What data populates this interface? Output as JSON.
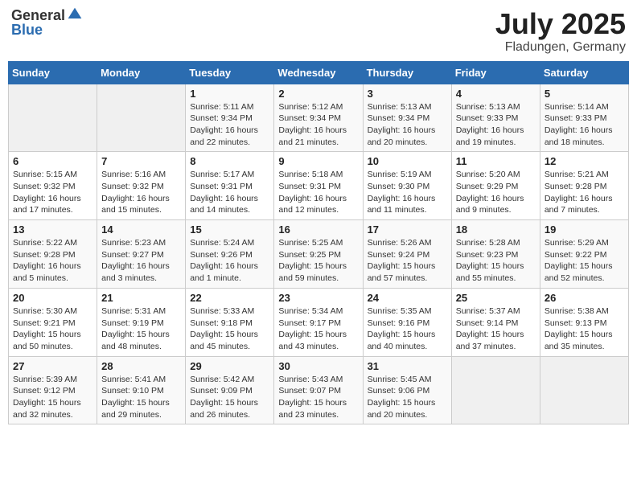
{
  "header": {
    "logo_general": "General",
    "logo_blue": "Blue",
    "month": "July 2025",
    "location": "Fladungen, Germany"
  },
  "weekdays": [
    "Sunday",
    "Monday",
    "Tuesday",
    "Wednesday",
    "Thursday",
    "Friday",
    "Saturday"
  ],
  "weeks": [
    [
      {
        "day": "",
        "content": ""
      },
      {
        "day": "",
        "content": ""
      },
      {
        "day": "1",
        "content": "Sunrise: 5:11 AM\nSunset: 9:34 PM\nDaylight: 16 hours and 22 minutes."
      },
      {
        "day": "2",
        "content": "Sunrise: 5:12 AM\nSunset: 9:34 PM\nDaylight: 16 hours and 21 minutes."
      },
      {
        "day": "3",
        "content": "Sunrise: 5:13 AM\nSunset: 9:34 PM\nDaylight: 16 hours and 20 minutes."
      },
      {
        "day": "4",
        "content": "Sunrise: 5:13 AM\nSunset: 9:33 PM\nDaylight: 16 hours and 19 minutes."
      },
      {
        "day": "5",
        "content": "Sunrise: 5:14 AM\nSunset: 9:33 PM\nDaylight: 16 hours and 18 minutes."
      }
    ],
    [
      {
        "day": "6",
        "content": "Sunrise: 5:15 AM\nSunset: 9:32 PM\nDaylight: 16 hours and 17 minutes."
      },
      {
        "day": "7",
        "content": "Sunrise: 5:16 AM\nSunset: 9:32 PM\nDaylight: 16 hours and 15 minutes."
      },
      {
        "day": "8",
        "content": "Sunrise: 5:17 AM\nSunset: 9:31 PM\nDaylight: 16 hours and 14 minutes."
      },
      {
        "day": "9",
        "content": "Sunrise: 5:18 AM\nSunset: 9:31 PM\nDaylight: 16 hours and 12 minutes."
      },
      {
        "day": "10",
        "content": "Sunrise: 5:19 AM\nSunset: 9:30 PM\nDaylight: 16 hours and 11 minutes."
      },
      {
        "day": "11",
        "content": "Sunrise: 5:20 AM\nSunset: 9:29 PM\nDaylight: 16 hours and 9 minutes."
      },
      {
        "day": "12",
        "content": "Sunrise: 5:21 AM\nSunset: 9:28 PM\nDaylight: 16 hours and 7 minutes."
      }
    ],
    [
      {
        "day": "13",
        "content": "Sunrise: 5:22 AM\nSunset: 9:28 PM\nDaylight: 16 hours and 5 minutes."
      },
      {
        "day": "14",
        "content": "Sunrise: 5:23 AM\nSunset: 9:27 PM\nDaylight: 16 hours and 3 minutes."
      },
      {
        "day": "15",
        "content": "Sunrise: 5:24 AM\nSunset: 9:26 PM\nDaylight: 16 hours and 1 minute."
      },
      {
        "day": "16",
        "content": "Sunrise: 5:25 AM\nSunset: 9:25 PM\nDaylight: 15 hours and 59 minutes."
      },
      {
        "day": "17",
        "content": "Sunrise: 5:26 AM\nSunset: 9:24 PM\nDaylight: 15 hours and 57 minutes."
      },
      {
        "day": "18",
        "content": "Sunrise: 5:28 AM\nSunset: 9:23 PM\nDaylight: 15 hours and 55 minutes."
      },
      {
        "day": "19",
        "content": "Sunrise: 5:29 AM\nSunset: 9:22 PM\nDaylight: 15 hours and 52 minutes."
      }
    ],
    [
      {
        "day": "20",
        "content": "Sunrise: 5:30 AM\nSunset: 9:21 PM\nDaylight: 15 hours and 50 minutes."
      },
      {
        "day": "21",
        "content": "Sunrise: 5:31 AM\nSunset: 9:19 PM\nDaylight: 15 hours and 48 minutes."
      },
      {
        "day": "22",
        "content": "Sunrise: 5:33 AM\nSunset: 9:18 PM\nDaylight: 15 hours and 45 minutes."
      },
      {
        "day": "23",
        "content": "Sunrise: 5:34 AM\nSunset: 9:17 PM\nDaylight: 15 hours and 43 minutes."
      },
      {
        "day": "24",
        "content": "Sunrise: 5:35 AM\nSunset: 9:16 PM\nDaylight: 15 hours and 40 minutes."
      },
      {
        "day": "25",
        "content": "Sunrise: 5:37 AM\nSunset: 9:14 PM\nDaylight: 15 hours and 37 minutes."
      },
      {
        "day": "26",
        "content": "Sunrise: 5:38 AM\nSunset: 9:13 PM\nDaylight: 15 hours and 35 minutes."
      }
    ],
    [
      {
        "day": "27",
        "content": "Sunrise: 5:39 AM\nSunset: 9:12 PM\nDaylight: 15 hours and 32 minutes."
      },
      {
        "day": "28",
        "content": "Sunrise: 5:41 AM\nSunset: 9:10 PM\nDaylight: 15 hours and 29 minutes."
      },
      {
        "day": "29",
        "content": "Sunrise: 5:42 AM\nSunset: 9:09 PM\nDaylight: 15 hours and 26 minutes."
      },
      {
        "day": "30",
        "content": "Sunrise: 5:43 AM\nSunset: 9:07 PM\nDaylight: 15 hours and 23 minutes."
      },
      {
        "day": "31",
        "content": "Sunrise: 5:45 AM\nSunset: 9:06 PM\nDaylight: 15 hours and 20 minutes."
      },
      {
        "day": "",
        "content": ""
      },
      {
        "day": "",
        "content": ""
      }
    ]
  ]
}
